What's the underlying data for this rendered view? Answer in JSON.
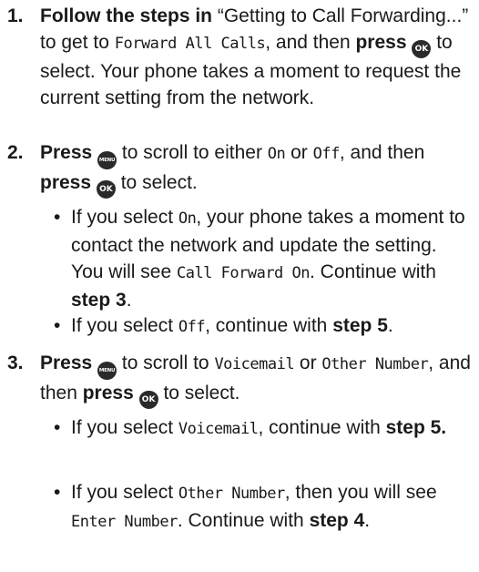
{
  "step1": {
    "num": "1.",
    "lead": "Follow the steps in",
    "t1": " “Getting to Call Forwarding...” to get to ",
    "lcd1": "Forward All Calls",
    "t2": ", and then ",
    "press": "press",
    "t3": " to select. Your phone takes a moment to request the current setting from the network."
  },
  "step2": {
    "num": "2.",
    "press1": "Press",
    "t1": " to scroll to either ",
    "lcd_on": "On",
    "t2": " or ",
    "lcd_off": "Off",
    "t3": ", and then ",
    "press2": "press",
    "t4": " to select.",
    "bullet1": {
      "dot": "•",
      "t1": "If you select ",
      "lcd1": "On",
      "t2": ", your phone takes a moment to contact the network and update the setting. You will see ",
      "lcd2": "Call Forward On",
      "t3": ". Continue with ",
      "ref": "step 3",
      "t4": "."
    },
    "bullet2": {
      "dot": "•",
      "t1": "If you select ",
      "lcd1": "Off",
      "t2": ", continue with ",
      "ref": "step 5",
      "t3": "."
    }
  },
  "step3": {
    "num": "3.",
    "press1": "Press",
    "t1": " to scroll to ",
    "lcd1": "Voicemail",
    "t2": " or ",
    "lcd2": "Other Number",
    "t3": ", and then ",
    "press2": "press",
    "t4": " to select.",
    "bullet1": {
      "dot": "•",
      "t1": "If you select ",
      "lcd1": "Voicemail",
      "t2": ", continue with ",
      "ref": "step 5."
    },
    "bullet2": {
      "dot": "•",
      "t1": "If you select ",
      "lcd1": "Other Number",
      "t2": ", then you will see ",
      "lcd2": "Enter Number",
      "t3": ". Continue with ",
      "ref": "step 4",
      "t4": "."
    }
  },
  "icons": {
    "ok_key_label": "OK",
    "menu_key_label": "MENU"
  }
}
